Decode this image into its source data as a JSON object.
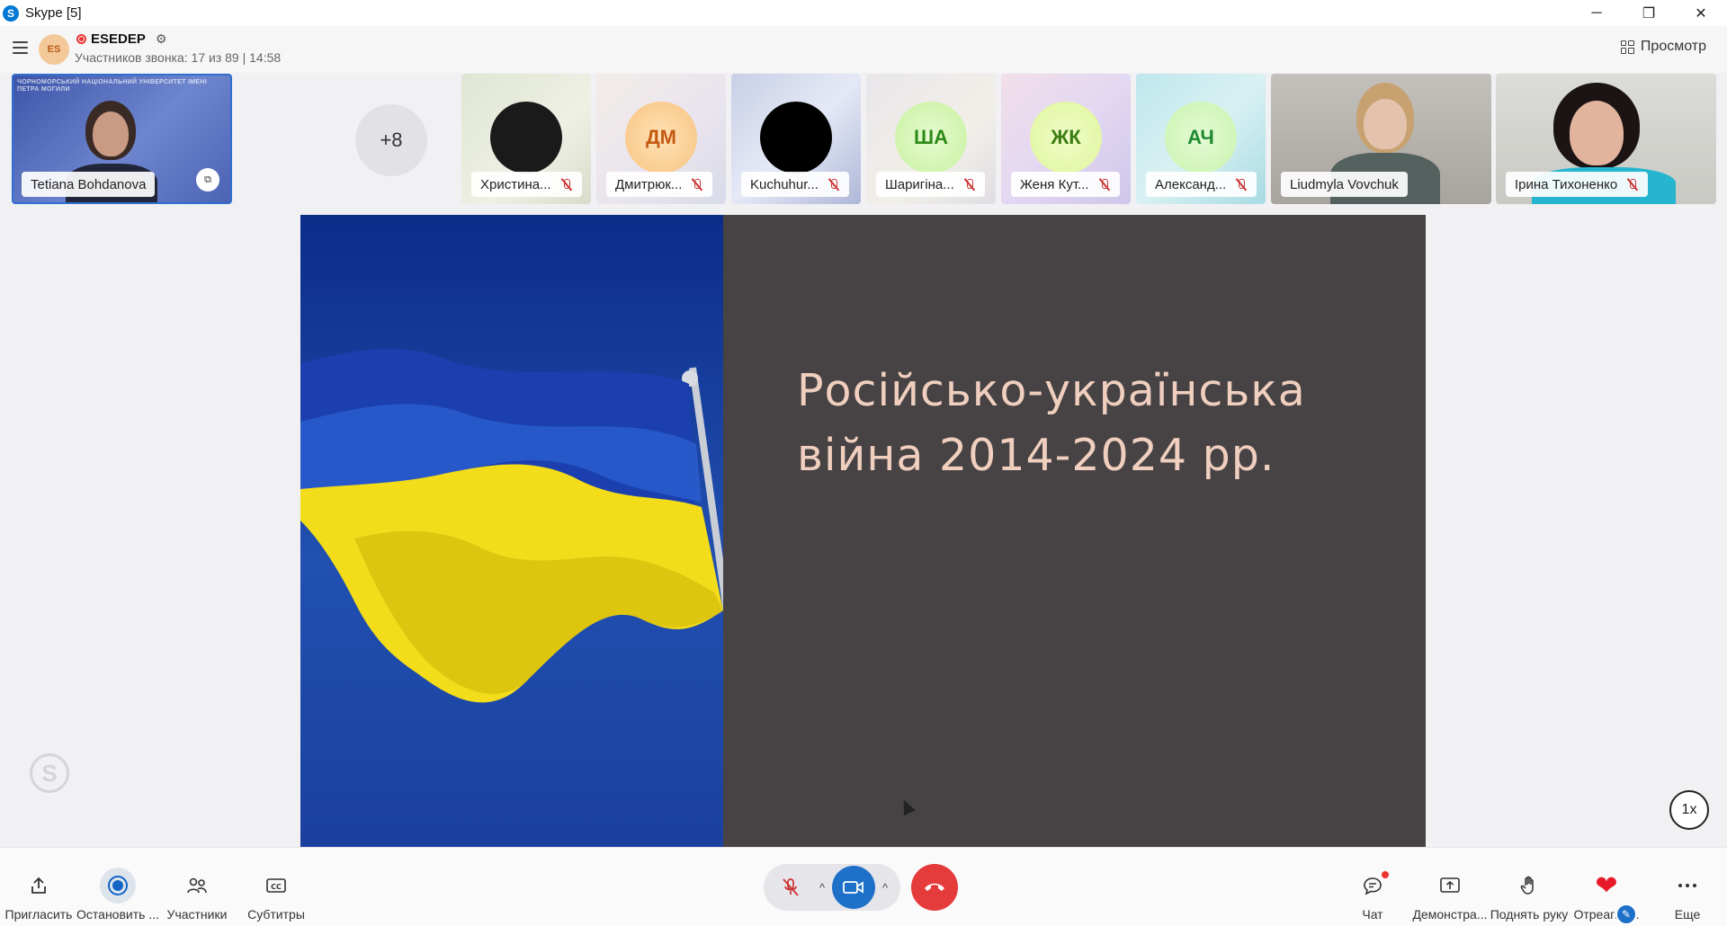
{
  "window": {
    "title": "Skype [5]",
    "minimize_glyph": "─",
    "restore_glyph": "❐",
    "close_glyph": "✕"
  },
  "call_header": {
    "avatar_initials": "ES",
    "group_name": "ESEDEP",
    "subtitle": "Участников звонка: 17 из 89 | 14:58",
    "view_label": "Просмотр"
  },
  "participants": {
    "presenter": {
      "name": "Tetiana Bohdanova",
      "slide_text": "ЧОРНОМОРСЬКИЙ НАЦІОНАЛЬНИЙ УНІВЕРСИТЕТ ІМЕНІ ПЕТРА МОГИЛИ"
    },
    "more_count": "+8",
    "tiles": [
      {
        "name": "Христина...",
        "initials": "",
        "muted": true
      },
      {
        "name": "Дмитрюк...",
        "initials": "ДМ",
        "muted": true
      },
      {
        "name": "Kuchuhur...",
        "initials": "",
        "muted": true
      },
      {
        "name": "Шаригіна...",
        "initials": "ША",
        "muted": true
      },
      {
        "name": "Женя Кут...",
        "initials": "ЖК",
        "muted": true
      },
      {
        "name": "Александ...",
        "initials": "АЧ",
        "muted": true
      },
      {
        "name": "Liudmyla Vovchuk",
        "initials": "",
        "muted": false
      },
      {
        "name": "Ірина Тихоненко",
        "initials": "",
        "muted": true
      }
    ]
  },
  "slide": {
    "title_line1": "Російсько-українська",
    "title_line2": "війна 2014-2024 рр."
  },
  "stage": {
    "watermark": "S",
    "zoom_level": "1x"
  },
  "toolbar": {
    "invite": "Пригласить",
    "stop_recording": "Остановить ...",
    "participants": "Участники",
    "subtitles": "Субтитры",
    "chat": "Чат",
    "share": "Демонстра...",
    "raise_hand": "Поднять руку",
    "react": "Отреагир...",
    "more": "Еще"
  },
  "colors": {
    "accent": "#1e70c9",
    "end_call": "#e63b3b",
    "record": "#1464c6",
    "slide_title": "#f0cfbf",
    "slide_bg": "#474344"
  }
}
